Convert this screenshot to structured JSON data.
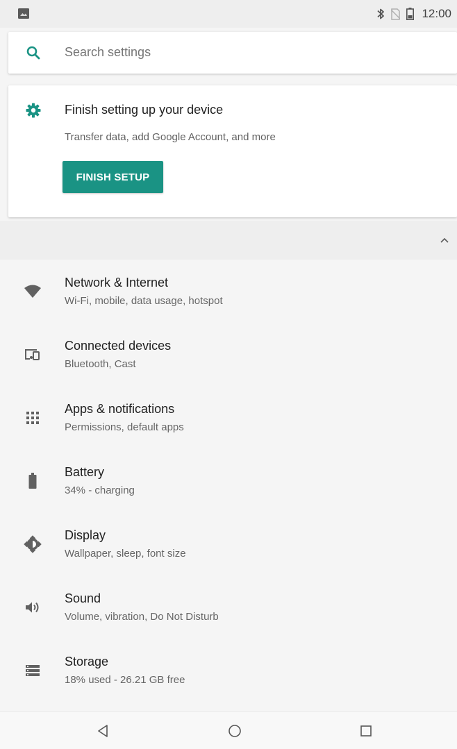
{
  "status_bar": {
    "time": "12:00",
    "left_icon": "image-notification-icon",
    "right_icons": [
      "bluetooth-icon",
      "no-sim-icon",
      "battery-icon"
    ]
  },
  "search": {
    "placeholder": "Search settings"
  },
  "setup_card": {
    "title": "Finish setting up your device",
    "subtitle": "Transfer data, add Google Account, and more",
    "button_label": "FINISH SETUP"
  },
  "settings": {
    "items": [
      {
        "icon": "wifi-icon",
        "title": "Network & Internet",
        "subtitle": "Wi-Fi, mobile, data usage, hotspot"
      },
      {
        "icon": "devices-icon",
        "title": "Connected devices",
        "subtitle": "Bluetooth, Cast"
      },
      {
        "icon": "apps-grid-icon",
        "title": "Apps & notifications",
        "subtitle": "Permissions, default apps"
      },
      {
        "icon": "battery-icon",
        "title": "Battery",
        "subtitle": "34% - charging"
      },
      {
        "icon": "brightness-icon",
        "title": "Display",
        "subtitle": "Wallpaper, sleep, font size"
      },
      {
        "icon": "volume-icon",
        "title": "Sound",
        "subtitle": "Volume, vibration, Do Not Disturb"
      },
      {
        "icon": "storage-icon",
        "title": "Storage",
        "subtitle": "18% used - 26.21 GB free"
      }
    ]
  },
  "nav_bar": {
    "buttons": [
      "back-icon",
      "home-icon",
      "recents-icon"
    ]
  },
  "colors": {
    "accent": "#1a9384",
    "icon_gray": "#616161",
    "background": "#f5f5f5"
  }
}
